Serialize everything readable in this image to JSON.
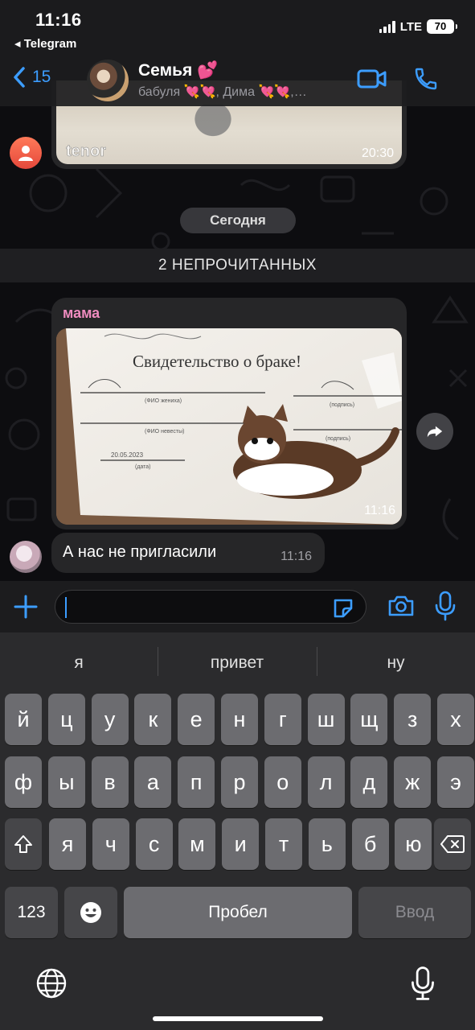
{
  "status_bar": {
    "time": "11:16",
    "back_app": "◂ Telegram",
    "network": "LTE",
    "battery": "70"
  },
  "header": {
    "back_count": "15",
    "title": "Семья 💕",
    "subtitle": "бабуля 💘💘, Дима 💘💘,…"
  },
  "messages": {
    "gif": {
      "watermark": "tenor",
      "time": "20:30"
    },
    "date_pill": "Сегодня",
    "unread_divider": "2 НЕПРОЧИТАННЫХ",
    "photo": {
      "sender": "мама",
      "time": "11:16",
      "doc_title": "Свидетельство о браке!",
      "field_groom": "(ФИО жениха)",
      "field_bride": "(ФИО невесты)",
      "field_sign": "(подпись)",
      "field_date": "(дата)",
      "date_value": "20.05.2023"
    },
    "text": {
      "body": "А нас не пригласили",
      "time": "11:16"
    }
  },
  "input": {
    "value": ""
  },
  "keyboard": {
    "suggestions": [
      "я",
      "привет",
      "ну"
    ],
    "row1": [
      "й",
      "ц",
      "у",
      "к",
      "е",
      "н",
      "г",
      "ш",
      "щ",
      "з",
      "х"
    ],
    "row2": [
      "ф",
      "ы",
      "в",
      "а",
      "п",
      "р",
      "о",
      "л",
      "д",
      "ж",
      "э"
    ],
    "row3": [
      "я",
      "ч",
      "с",
      "м",
      "и",
      "т",
      "ь",
      "б",
      "ю"
    ],
    "numbers_key": "123",
    "space_key": "Пробел",
    "return_key": "Ввод"
  },
  "colors": {
    "accent": "#3c9dff",
    "sender_name": "#f08cc0",
    "bubble": "#262628"
  }
}
